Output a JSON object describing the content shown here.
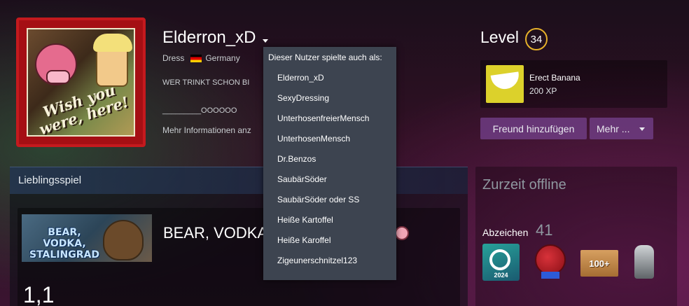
{
  "profile": {
    "persona_name": "Elderron_xD",
    "location_prefix": "Dress",
    "country": "Germany",
    "summary_line1": "WER TRINKT SCHON BI",
    "summary_line2": "_________OOOOOO",
    "more_info": "Mehr Informationen anz",
    "avatar_caption": "Wish you were, here!"
  },
  "level": {
    "label": "Level",
    "value": "34"
  },
  "featured_badge": {
    "name": "Erect Banana",
    "xp": "200 XP"
  },
  "actions": {
    "add_friend": "Freund hinzufügen",
    "more": "Mehr ..."
  },
  "favorite_game": {
    "header": "Lieblingsspiel",
    "capsule_text": "BEAR, VODKA, STALINGRAD",
    "title": "BEAR, VODKA",
    "hours": "1,1"
  },
  "status": {
    "text": "Zurzeit offline",
    "badges_label": "Abzeichen",
    "badges_count": "41",
    "badge_year": "2024",
    "badge_100": "100+"
  },
  "aliases": {
    "title": "Dieser Nutzer spielte auch als:",
    "items": [
      "Elderron_xD",
      "SexyDressing",
      "UnterhosenfreierMensch",
      "UnterhosenMensch",
      "Dr.Benzos",
      "SaubärSöder",
      "SaubärSöder oder SS",
      "Heiße Kartoffel",
      "Heiße Karoffel",
      "Zigeunerschnitzel123"
    ]
  }
}
